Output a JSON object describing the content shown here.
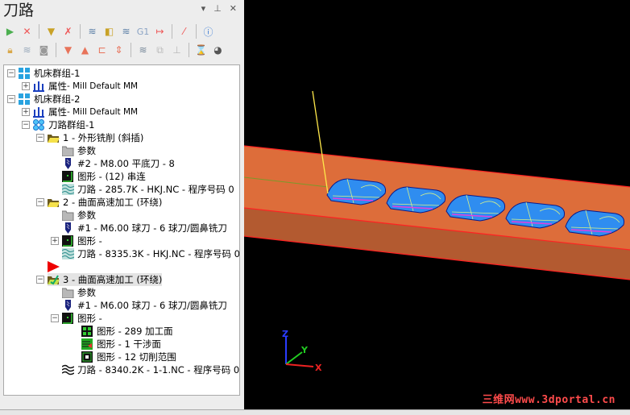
{
  "panel": {
    "title": "刀路",
    "controls": {
      "dropdown": "▾",
      "pin": "⊥",
      "close": "✕"
    }
  },
  "toolbar": {
    "row1": [
      "select-all-operations-icon",
      "deselect-all-icon",
      "regenerate-selected-icon",
      "regenerate-dirty-icon",
      "backplot-icon",
      "verify-icon",
      "simulate-icon",
      "post-selected-icon",
      "high-feed-icon",
      "lock-tool-icon",
      "help-icon"
    ],
    "row1_g1": "G1",
    "row2": [
      "lock-icon",
      "toggle-display-icon",
      "post-toggle-icon",
      "move-down-icon",
      "move-up-icon",
      "insert-arrow-icon",
      "scroll-icon",
      "single-display-icon",
      "display-selected-icon",
      "insert-position-icon",
      "compare-icon",
      "material-icon"
    ]
  },
  "tree": [
    {
      "level": 0,
      "exp": "-",
      "icon": "machine-group",
      "label": "机床群组-1"
    },
    {
      "level": 1,
      "exp": "+",
      "icon": "properties",
      "label": "属性",
      "sub": " - Mill Default MM"
    },
    {
      "level": 0,
      "exp": "-",
      "icon": "machine-group",
      "label": "机床群组-2"
    },
    {
      "level": 1,
      "exp": "+",
      "icon": "properties",
      "label": "属性",
      "sub": " - Mill Default MM"
    },
    {
      "level": 1,
      "exp": "-",
      "icon": "toolpath-group",
      "label": "刀路群组-1"
    },
    {
      "level": 2,
      "exp": "-",
      "icon": "op-folder",
      "label": "1 - 外形铣削 (斜插)"
    },
    {
      "level": 3,
      "icon": "params",
      "label": "参数"
    },
    {
      "level": 3,
      "icon": "tool",
      "label": "#2 - M8.00 平底刀 - 8"
    },
    {
      "level": 3,
      "icon": "geometry",
      "label": "图形 - (12) 串连"
    },
    {
      "level": 3,
      "icon": "toolpath",
      "label": "刀路 - 285.7K - HKJ.NC - 程序号码 0"
    },
    {
      "level": 2,
      "exp": "-",
      "icon": "op-folder",
      "label": "2 - 曲面高速加工 (环绕)"
    },
    {
      "level": 3,
      "icon": "params",
      "label": "参数"
    },
    {
      "level": 3,
      "icon": "tool",
      "label": "#1 - M6.00 球刀 - 6 球刀/圆鼻铣刀"
    },
    {
      "level": 3,
      "exp": "+",
      "icon": "geometry",
      "label": "图形 -"
    },
    {
      "level": 3,
      "icon": "toolpath",
      "label": "刀路 - 8335.3K - HKJ.NC - 程序号码 0"
    },
    {
      "level": 2,
      "icon": "insert-arrow",
      "label": ""
    },
    {
      "level": 2,
      "exp": "-",
      "icon": "op-folder-dirty",
      "label": "3 - 曲面高速加工 (环绕)",
      "selected": true
    },
    {
      "level": 3,
      "icon": "params",
      "label": "参数"
    },
    {
      "level": 3,
      "icon": "tool",
      "label": "#1 - M6.00 球刀 - 6 球刀/圆鼻铣刀"
    },
    {
      "level": 3,
      "exp": "-",
      "icon": "geometry",
      "label": "图形 -"
    },
    {
      "level": 4,
      "icon": "geo-drive",
      "label": "图形 - 289 加工面"
    },
    {
      "level": 4,
      "icon": "geo-check",
      "label": "图形 - 1 干涉面"
    },
    {
      "level": 4,
      "icon": "geo-boundary",
      "label": "图形 - 12 切削范围"
    },
    {
      "level": 3,
      "icon": "toolpath-dirty",
      "label": "刀路 - 8340.2K - 1-1.NC - 程序号码 0"
    }
  ],
  "viewport": {
    "axes": {
      "x": "X",
      "y": "Y",
      "z": "Z"
    },
    "watermark": "三维网www.3dportal.cn"
  }
}
